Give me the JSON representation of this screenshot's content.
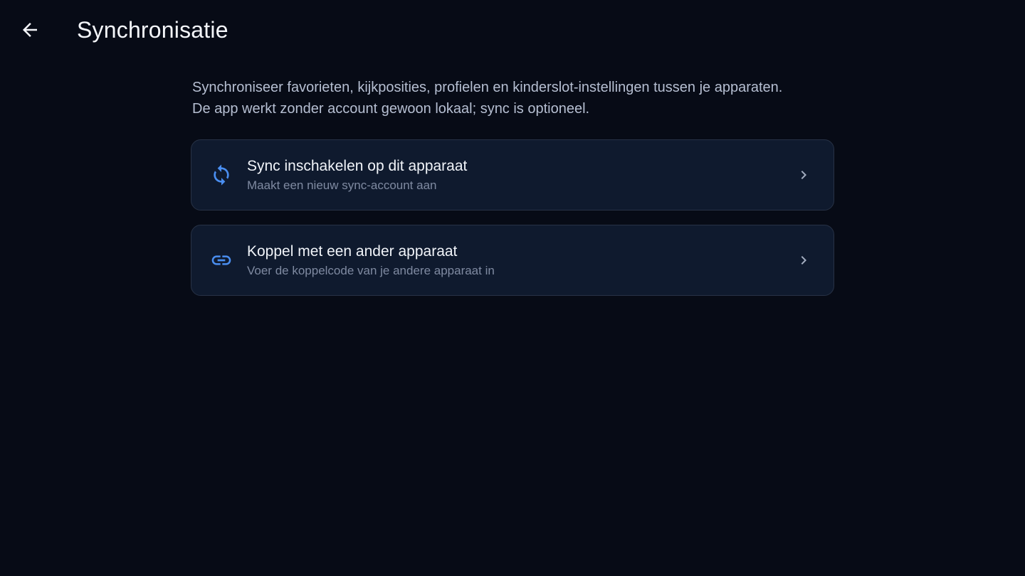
{
  "header": {
    "title": "Synchronisatie",
    "back_icon": "arrow-left-icon"
  },
  "description": {
    "line1": "Synchroniseer favorieten, kijkposities, profielen en kinderslot-instellingen tussen je apparaten.",
    "line2": "De app werkt zonder account gewoon lokaal; sync is optioneel."
  },
  "options": [
    {
      "icon": "sync-icon",
      "title": "Sync inschakelen op dit apparaat",
      "subtitle": "Maakt een nieuw sync-account aan"
    },
    {
      "icon": "link-icon",
      "title": "Koppel met een ander apparaat",
      "subtitle": "Voer de koppelcode van je andere apparaat in"
    }
  ],
  "colors": {
    "background": "#070b16",
    "card_background": "#0f1a2e",
    "card_border": "#273246",
    "accent": "#4a8ef0",
    "title_text": "#f4f6fa",
    "secondary_text": "#7f8aa1"
  }
}
